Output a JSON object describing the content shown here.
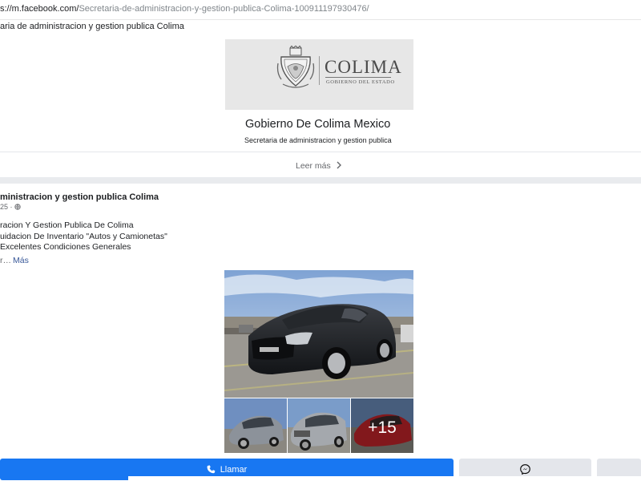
{
  "browser": {
    "url_host": "s://m.facebook.com/",
    "url_path": "Secretaria-de-administracion-y-gestion-publica-Colima-100911197930476/"
  },
  "page": {
    "header_title": "aria de administracion y gestion publica Colima",
    "logo": {
      "title": "COLIMA",
      "subtitle": "GOBIERNO DEL ESTADO",
      "crest_icon": "colima-crest-icon"
    },
    "org_name": "Gobierno De Colima Mexico",
    "org_description": "Secretaria de administracion y gestion publica",
    "read_more_label": "Leer más",
    "read_more_icon": "chevron-right-icon"
  },
  "post": {
    "author": "ministracion y gestion publica Colima",
    "meta_time": "25",
    "meta_icon": "globe-icon",
    "lines": [
      "racion Y Gestion Publica De Colima",
      "uidacion De Inventario \"Autos y Camionetas\"",
      "Excelentes Condiciones Generales"
    ],
    "more_prefix": "r…",
    "more_label": "Más",
    "photos": {
      "main": "black-sedan-photo",
      "thumbs": [
        "silver-hatchback-photo",
        "silver-suv-photo",
        "red-car-photo"
      ],
      "extra_count": "+15"
    }
  },
  "actions": {
    "call_label": "Llamar",
    "call_icon": "phone-icon",
    "messenger_icon": "messenger-icon",
    "brand_color": "#1877f2"
  }
}
